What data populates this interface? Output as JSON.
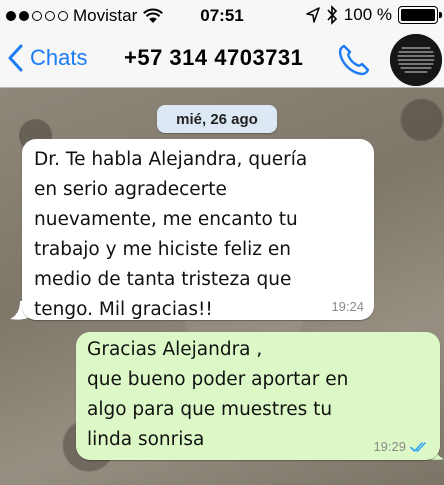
{
  "status_bar": {
    "carrier": "Movistar",
    "signal_bars": 2,
    "signal_total": 5,
    "time": "07:51",
    "battery": "100 %",
    "battery_level": 1.0,
    "icons": [
      "wifi-icon",
      "location-arrow-icon",
      "bluetooth-icon",
      "battery-icon"
    ]
  },
  "nav": {
    "back_label": "Chats",
    "contact": "+57 314 4703731",
    "icons": [
      "chevron-left-icon",
      "phone-icon",
      "avatar"
    ]
  },
  "chat": {
    "date_chip": "mié, 26 ago",
    "messages": [
      {
        "direction": "incoming",
        "lines": [
          "Dr. Te habla Alejandra, quería",
          "en serio agradecerte",
          "nuevamente, me encanto tu",
          "trabajo y me hiciste feliz en",
          "medio de tanta tristeza que",
          "tengo. Mil gracias!!"
        ],
        "time": "19:24"
      },
      {
        "direction": "outgoing",
        "lines": [
          "Gracias Alejandra ,",
          "que bueno poder aportar en",
          "algo para que muestres tu",
          "linda sonrisa"
        ],
        "time": "19:29",
        "status": "read"
      }
    ]
  },
  "colors": {
    "accent": "#1b7cf5",
    "outgoing_bubble": "#dcf8c6",
    "incoming_bubble": "#ffffff",
    "date_chip": "#dce9f5",
    "read_ticks": "#34a4f5"
  }
}
